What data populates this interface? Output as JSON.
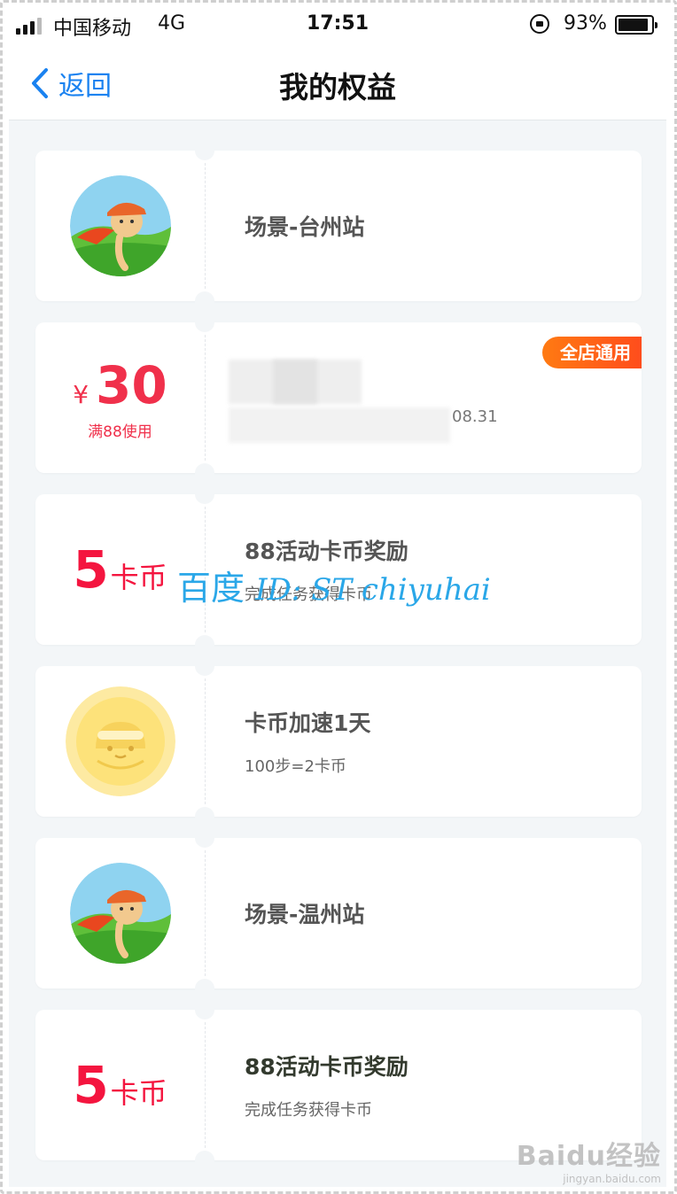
{
  "status_bar": {
    "carrier": "中国移动",
    "network": "4G",
    "time": "17:51",
    "battery": "93%",
    "battery_level": 0.93
  },
  "nav": {
    "back_label": "返回",
    "title": "我的权益"
  },
  "cards": [
    {
      "type": "scene",
      "title": "场景-台州站"
    },
    {
      "type": "coupon",
      "currency": "¥",
      "amount": "30",
      "condition": "满88使用",
      "badge": "全店通用",
      "date_fragment": "08.31"
    },
    {
      "type": "coins",
      "amount": "5",
      "unit": "卡币",
      "title": "88活动卡币奖励",
      "subtitle": "完成任务获得卡币"
    },
    {
      "type": "boost",
      "title": "卡币加速1天",
      "subtitle": "100步=2卡币"
    },
    {
      "type": "scene",
      "title": "场景-温州站"
    },
    {
      "type": "coins",
      "amount": "5",
      "unit": "卡币",
      "title": "88活动卡币奖励",
      "subtitle": "完成任务获得卡币"
    }
  ],
  "watermark": {
    "cn": "百度",
    "latin": "ID: ST chiyuhai"
  },
  "baidu_mark": {
    "logo": "Baidu经验",
    "url": "jingyan.baidu.com"
  },
  "colors": {
    "accent_blue": "#1a82f0",
    "price_red": "#f0304b",
    "badge_orange": "#ff7a12",
    "background": "#f3f6f8"
  }
}
